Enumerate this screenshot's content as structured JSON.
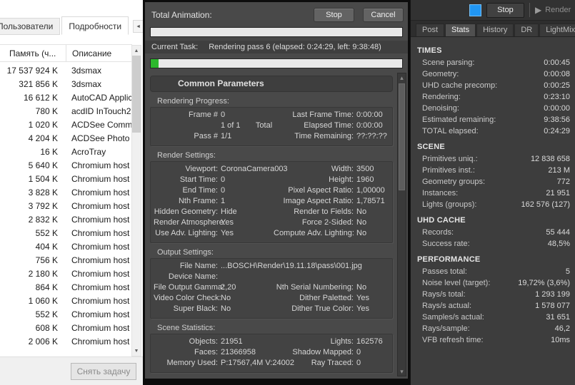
{
  "icons": {
    "tabScrollLeft": "◄",
    "tabScrollRight": "►",
    "scrollUp": "▲",
    "scrollDown": "▼",
    "smallUp": "▴",
    "smallDown": "▾",
    "play": "▶"
  },
  "colors": {
    "progressGreen": "#2db82d",
    "coronaBlue": "#2196f3"
  },
  "taskManager": {
    "tabs": [
      {
        "label": "Пользователи"
      },
      {
        "label": "Подробности"
      }
    ],
    "columns": {
      "memory": "Память (ч...",
      "description": "Описание"
    },
    "rows": [
      [
        "17 537 924 K",
        "3dsmax"
      ],
      [
        "321 856 K",
        "3dsmax"
      ],
      [
        "16 612 K",
        "AutoCAD Applica"
      ],
      [
        "780 K",
        "acdID InTouch2"
      ],
      [
        "1 020 K",
        "ACDSee Commar"
      ],
      [
        "4 204 K",
        "ACDSee Photo Stu"
      ],
      [
        "16 K",
        "AcroTray"
      ],
      [
        "5 640 K",
        "Chromium host e"
      ],
      [
        "1 504 K",
        "Chromium host e"
      ],
      [
        "3 828 K",
        "Chromium host e"
      ],
      [
        "3 792 K",
        "Chromium host e"
      ],
      [
        "2 832 K",
        "Chromium host e"
      ],
      [
        "552 K",
        "Chromium host e"
      ],
      [
        "404 K",
        "Chromium host e"
      ],
      [
        "756 K",
        "Chromium host e"
      ],
      [
        "2 180 K",
        "Chromium host e"
      ],
      [
        "864 K",
        "Chromium host e"
      ],
      [
        "1 060 K",
        "Chromium host e"
      ],
      [
        "552 K",
        "Chromium host e"
      ],
      [
        "608 K",
        "Chromium host e"
      ],
      [
        "2 006 K",
        "Chromium host e"
      ]
    ],
    "endTaskButton": "Снять задачу"
  },
  "renderDialog": {
    "totalAnimationLabel": "Total Animation:",
    "stopButton": "Stop",
    "cancelButton": "Cancel",
    "currentTaskLabel": "Current Task:",
    "currentTaskText": "Rendering pass 6 (elapsed: 0:24:29, left: 9:38:48)",
    "taskProgressPercent": 3,
    "rolloutTitle": "Common Parameters",
    "sections": [
      {
        "title": "Rendering Progress:",
        "rows": [
          [
            "Frame #",
            "0",
            "Last Frame Time:",
            "0:00:00"
          ],
          [
            "",
            "1 of 1       Total",
            "Elapsed Time:",
            "0:00:00"
          ],
          [
            "Pass #",
            "1/1",
            "Time Remaining:",
            "??:??:??"
          ]
        ]
      },
      {
        "title": "Render Settings:",
        "rows": [
          [
            "Viewport:",
            "CoronaCamera003",
            "Width:",
            "3500"
          ],
          [
            "Start Time:",
            "0",
            "Height:",
            "1960"
          ],
          [
            "End Time:",
            "0",
            "Pixel Aspect Ratio:",
            "1,00000"
          ],
          [
            "Nth Frame:",
            "1",
            "Image Aspect Ratio:",
            "1,78571"
          ],
          [
            "Hidden Geometry:",
            "Hide",
            "Render to Fields:",
            "No"
          ],
          [
            "Render Atmosphere:",
            "Yes",
            "Force 2-Sided:",
            "No"
          ],
          [
            "Use Adv. Lighting:",
            "Yes",
            "Compute Adv. Lighting:",
            "No"
          ]
        ]
      },
      {
        "title": "Output Settings:",
        "rows": [
          [
            "File Name:",
            "...BOSCH\\Render\\19.11.18\\pass\\001.jpg"
          ],
          [
            "Device Name:",
            ""
          ],
          [
            "File Output Gamma:",
            "2,20",
            "Nth Serial Numbering:",
            "No"
          ],
          [
            "Video Color Check:",
            "No",
            "Dither Paletted:",
            "Yes"
          ],
          [
            "Super Black:",
            "No",
            "Dither True Color:",
            "Yes"
          ]
        ]
      },
      {
        "title": "Scene Statistics:",
        "rows": [
          [
            "Objects:",
            "21951",
            "Lights:",
            "162576"
          ],
          [
            "Faces:",
            "21366958",
            "Shadow Mapped:",
            "0"
          ],
          [
            "Memory Used:",
            "P:17567,4M V:24002",
            "Ray Traced:",
            "0"
          ]
        ]
      }
    ]
  },
  "corona": {
    "stopButton": "Stop",
    "renderButton": "Render",
    "tabs": [
      "Post",
      "Stats",
      "History",
      "DR",
      "LightMix"
    ],
    "activeTab": "Stats",
    "sections": [
      {
        "title": "TIMES",
        "rows": [
          [
            "Scene parsing:",
            "0:00:45"
          ],
          [
            "Geometry:",
            "0:00:08"
          ],
          [
            "UHD cache precomp:",
            "0:00:25"
          ],
          [
            "Rendering:",
            "0:23:10"
          ],
          [
            "Denoising:",
            "0:00:00"
          ],
          [
            "Estimated remaining:",
            "9:38:56"
          ],
          [
            "TOTAL elapsed:",
            "0:24:29"
          ]
        ]
      },
      {
        "title": "SCENE",
        "rows": [
          [
            "Primitives uniq.:",
            "12 838 658"
          ],
          [
            "Primitives inst.:",
            "213 M"
          ],
          [
            "Geometry groups:",
            "772"
          ],
          [
            "Instances:",
            "21 951"
          ],
          [
            "Lights (groups):",
            "162 576 (127)"
          ]
        ]
      },
      {
        "title": "UHD CACHE",
        "rows": [
          [
            "Records:",
            "55 444"
          ],
          [
            "Success rate:",
            "48,5%"
          ]
        ]
      },
      {
        "title": "PERFORMANCE",
        "rows": [
          [
            "Passes total:",
            "5"
          ],
          [
            "Noise level (target):",
            "19,72% (3,6%)"
          ],
          [
            "Rays/s total:",
            "1 293 199"
          ],
          [
            "Rays/s actual:",
            "1 578 077"
          ],
          [
            "Samples/s actual:",
            "31 651"
          ],
          [
            "Rays/sample:",
            "46,2"
          ],
          [
            "VFB refresh time:",
            "10ms"
          ]
        ]
      }
    ]
  }
}
